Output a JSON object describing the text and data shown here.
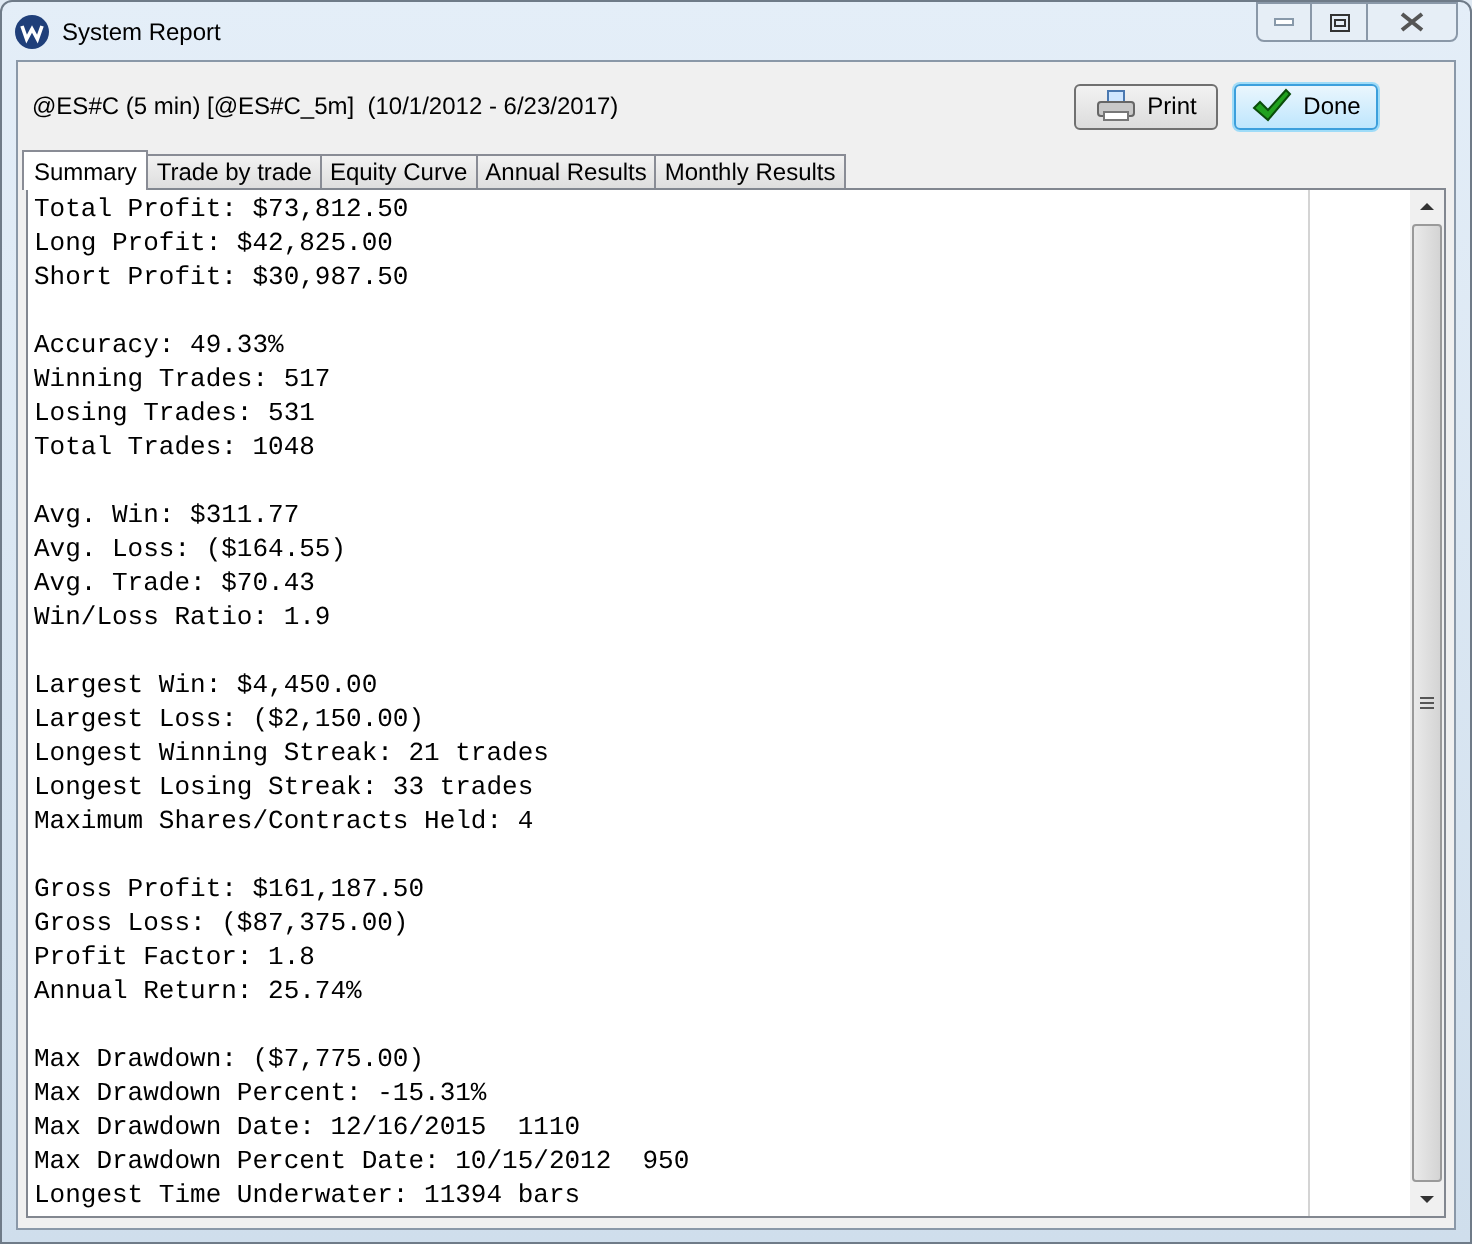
{
  "window": {
    "title": "System Report"
  },
  "header": {
    "source": "@ES#C (5 min) [@ES#C_5m]  (10/1/2012 - 6/23/2017)"
  },
  "buttons": [
    {
      "kind": "print",
      "label": "Print",
      "focused": false
    },
    {
      "kind": "done",
      "label": "Done",
      "focused": true
    }
  ],
  "tabs": [
    {
      "label": "Summary",
      "selected": true
    },
    {
      "label": "Trade by trade",
      "selected": false
    },
    {
      "label": "Equity Curve",
      "selected": false
    },
    {
      "label": "Annual Results",
      "selected": false
    },
    {
      "label": "Monthly Results",
      "selected": false
    }
  ],
  "report": {
    "sections": [
      [
        "Total Profit: $73,812.50",
        "Long Profit: $42,825.00",
        "Short Profit: $30,987.50"
      ],
      [
        "Accuracy: 49.33%",
        "Winning Trades: 517",
        "Losing Trades: 531",
        "Total Trades: 1048"
      ],
      [
        "Avg. Win: $311.77",
        "Avg. Loss: ($164.55)",
        "Avg. Trade: $70.43",
        "Win/Loss Ratio: 1.9"
      ],
      [
        "Largest Win: $4,450.00",
        "Largest Loss: ($2,150.00)",
        "Longest Winning Streak: 21 trades",
        "Longest Losing Streak: 33 trades",
        "Maximum Shares/Contracts Held: 4"
      ],
      [
        "Gross Profit: $161,187.50",
        "Gross Loss: ($87,375.00)",
        "Profit Factor: 1.8",
        "Annual Return: 25.74%"
      ],
      [
        "Max Drawdown: ($7,775.00)",
        "Max Drawdown Percent: -15.31%",
        "Max Drawdown Date: 12/16/2015  1110",
        "Max Drawdown Percent Date: 10/15/2012  950",
        "Longest Time Underwater: 11394 bars"
      ]
    ]
  }
}
